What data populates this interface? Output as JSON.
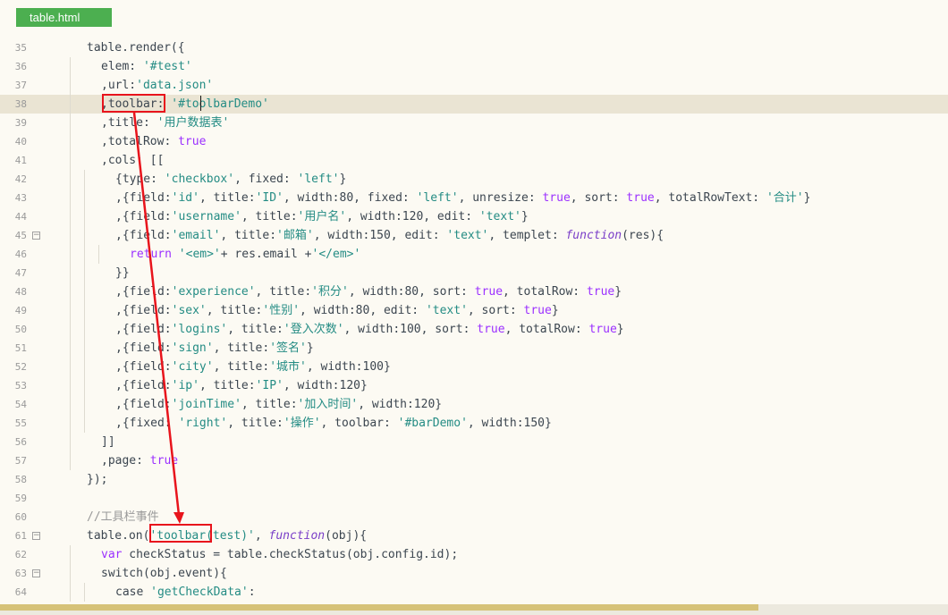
{
  "tab": {
    "label": "table.html"
  },
  "colors": {
    "string": "#248c84",
    "keyword": "#9b30ff",
    "comment": "#999999",
    "highlight": "#e8141c",
    "tab": "#4caf50"
  },
  "lines": [
    {
      "n": "35",
      "indent": 1,
      "tokens": [
        [
          "id",
          "table.render({"
        ]
      ]
    },
    {
      "n": "36",
      "indent": 2,
      "tokens": [
        [
          "id",
          "elem: "
        ],
        [
          "str",
          "'#test'"
        ]
      ]
    },
    {
      "n": "37",
      "indent": 2,
      "tokens": [
        [
          "id",
          ",url:"
        ],
        [
          "str",
          "'data.json'"
        ]
      ]
    },
    {
      "n": "38",
      "indent": 2,
      "active": true,
      "tokens": [
        [
          "id",
          ",toolbar: "
        ],
        [
          "str",
          "'#toolbarDemo'"
        ]
      ]
    },
    {
      "n": "39",
      "indent": 2,
      "tokens": [
        [
          "id",
          ",title: "
        ],
        [
          "str",
          "'用户数据表'"
        ]
      ]
    },
    {
      "n": "40",
      "indent": 2,
      "tokens": [
        [
          "id",
          ",totalRow: "
        ],
        [
          "kw",
          "true"
        ]
      ]
    },
    {
      "n": "41",
      "indent": 2,
      "tokens": [
        [
          "id",
          ",cols: [["
        ]
      ]
    },
    {
      "n": "42",
      "indent": 3,
      "tokens": [
        [
          "id",
          "{type: "
        ],
        [
          "str",
          "'checkbox'"
        ],
        [
          "id",
          ", fixed: "
        ],
        [
          "str",
          "'left'"
        ],
        [
          "id",
          "}"
        ]
      ]
    },
    {
      "n": "43",
      "indent": 3,
      "tokens": [
        [
          "id",
          ",{field:"
        ],
        [
          "str",
          "'id'"
        ],
        [
          "id",
          ", title:"
        ],
        [
          "str",
          "'ID'"
        ],
        [
          "id",
          ", width:80, fixed: "
        ],
        [
          "str",
          "'left'"
        ],
        [
          "id",
          ", unresize: "
        ],
        [
          "kw",
          "true"
        ],
        [
          "id",
          ", sort: "
        ],
        [
          "kw",
          "true"
        ],
        [
          "id",
          ", totalRowText: "
        ],
        [
          "str",
          "'合计'"
        ],
        [
          "id",
          "}"
        ]
      ]
    },
    {
      "n": "44",
      "indent": 3,
      "tokens": [
        [
          "id",
          ",{field:"
        ],
        [
          "str",
          "'username'"
        ],
        [
          "id",
          ", title:"
        ],
        [
          "str",
          "'用户名'"
        ],
        [
          "id",
          ", width:120, edit: "
        ],
        [
          "str",
          "'text'"
        ],
        [
          "id",
          "}"
        ]
      ]
    },
    {
      "n": "45",
      "indent": 3,
      "fold": true,
      "tokens": [
        [
          "id",
          ",{field:"
        ],
        [
          "str",
          "'email'"
        ],
        [
          "id",
          ", title:"
        ],
        [
          "str",
          "'邮箱'"
        ],
        [
          "id",
          ", width:150, edit: "
        ],
        [
          "str",
          "'text'"
        ],
        [
          "id",
          ", templet: "
        ],
        [
          "fn",
          "function"
        ],
        [
          "id",
          "(res){"
        ]
      ]
    },
    {
      "n": "46",
      "indent": 4,
      "tokens": [
        [
          "kw",
          "return"
        ],
        [
          "id",
          " "
        ],
        [
          "str",
          "'<em>'"
        ],
        [
          "id",
          "+ res.email +"
        ],
        [
          "str",
          "'</em>'"
        ]
      ]
    },
    {
      "n": "47",
      "indent": 3,
      "tokens": [
        [
          "id",
          "}}"
        ]
      ]
    },
    {
      "n": "48",
      "indent": 3,
      "tokens": [
        [
          "id",
          ",{field:"
        ],
        [
          "str",
          "'experience'"
        ],
        [
          "id",
          ", title:"
        ],
        [
          "str",
          "'积分'"
        ],
        [
          "id",
          ", width:80, sort: "
        ],
        [
          "kw",
          "true"
        ],
        [
          "id",
          ", totalRow: "
        ],
        [
          "kw",
          "true"
        ],
        [
          "id",
          "}"
        ]
      ]
    },
    {
      "n": "49",
      "indent": 3,
      "tokens": [
        [
          "id",
          ",{field:"
        ],
        [
          "str",
          "'sex'"
        ],
        [
          "id",
          ", title:"
        ],
        [
          "str",
          "'性别'"
        ],
        [
          "id",
          ", width:80, edit: "
        ],
        [
          "str",
          "'text'"
        ],
        [
          "id",
          ", sort: "
        ],
        [
          "kw",
          "true"
        ],
        [
          "id",
          "}"
        ]
      ]
    },
    {
      "n": "50",
      "indent": 3,
      "tokens": [
        [
          "id",
          ",{field:"
        ],
        [
          "str",
          "'logins'"
        ],
        [
          "id",
          ", title:"
        ],
        [
          "str",
          "'登入次数'"
        ],
        [
          "id",
          ", width:100, sort: "
        ],
        [
          "kw",
          "true"
        ],
        [
          "id",
          ", totalRow: "
        ],
        [
          "kw",
          "true"
        ],
        [
          "id",
          "}"
        ]
      ]
    },
    {
      "n": "51",
      "indent": 3,
      "tokens": [
        [
          "id",
          ",{field:"
        ],
        [
          "str",
          "'sign'"
        ],
        [
          "id",
          ", title:"
        ],
        [
          "str",
          "'签名'"
        ],
        [
          "id",
          "}"
        ]
      ]
    },
    {
      "n": "52",
      "indent": 3,
      "tokens": [
        [
          "id",
          ",{field:"
        ],
        [
          "str",
          "'city'"
        ],
        [
          "id",
          ", title:"
        ],
        [
          "str",
          "'城市'"
        ],
        [
          "id",
          ", width:100}"
        ]
      ]
    },
    {
      "n": "53",
      "indent": 3,
      "tokens": [
        [
          "id",
          ",{field:"
        ],
        [
          "str",
          "'ip'"
        ],
        [
          "id",
          ", title:"
        ],
        [
          "str",
          "'IP'"
        ],
        [
          "id",
          ", width:120}"
        ]
      ]
    },
    {
      "n": "54",
      "indent": 3,
      "tokens": [
        [
          "id",
          ",{field:"
        ],
        [
          "str",
          "'joinTime'"
        ],
        [
          "id",
          ", title:"
        ],
        [
          "str",
          "'加入时间'"
        ],
        [
          "id",
          ", width:120}"
        ]
      ]
    },
    {
      "n": "55",
      "indent": 3,
      "tokens": [
        [
          "id",
          ",{fixed: "
        ],
        [
          "str",
          "'right'"
        ],
        [
          "id",
          ", title:"
        ],
        [
          "str",
          "'操作'"
        ],
        [
          "id",
          ", toolbar: "
        ],
        [
          "str",
          "'#barDemo'"
        ],
        [
          "id",
          ", width:150}"
        ]
      ]
    },
    {
      "n": "56",
      "indent": 2,
      "tokens": [
        [
          "id",
          "]]"
        ]
      ]
    },
    {
      "n": "57",
      "indent": 2,
      "tokens": [
        [
          "id",
          ",page: "
        ],
        [
          "kw",
          "true"
        ]
      ]
    },
    {
      "n": "58",
      "indent": 1,
      "tokens": [
        [
          "id",
          "});"
        ]
      ]
    },
    {
      "n": "59",
      "indent": 1,
      "tokens": []
    },
    {
      "n": "60",
      "indent": 1,
      "tokens": [
        [
          "cm",
          "//工具栏事件"
        ]
      ]
    },
    {
      "n": "61",
      "indent": 1,
      "fold": true,
      "tokens": [
        [
          "id",
          "table.on("
        ],
        [
          "str",
          "'toolbar(test)'"
        ],
        [
          "id",
          ", "
        ],
        [
          "fn",
          "function"
        ],
        [
          "id",
          "(obj){"
        ]
      ]
    },
    {
      "n": "62",
      "indent": 2,
      "tokens": [
        [
          "kw",
          "var"
        ],
        [
          "id",
          " checkStatus = table.checkStatus(obj.config.id);"
        ]
      ]
    },
    {
      "n": "63",
      "indent": 2,
      "fold": true,
      "tokens": [
        [
          "id",
          "switch(obj.event){"
        ]
      ]
    },
    {
      "n": "64",
      "indent": 3,
      "tokens": [
        [
          "id",
          "case "
        ],
        [
          "str",
          "'getCheckData'"
        ],
        [
          "id",
          ":"
        ]
      ]
    }
  ]
}
